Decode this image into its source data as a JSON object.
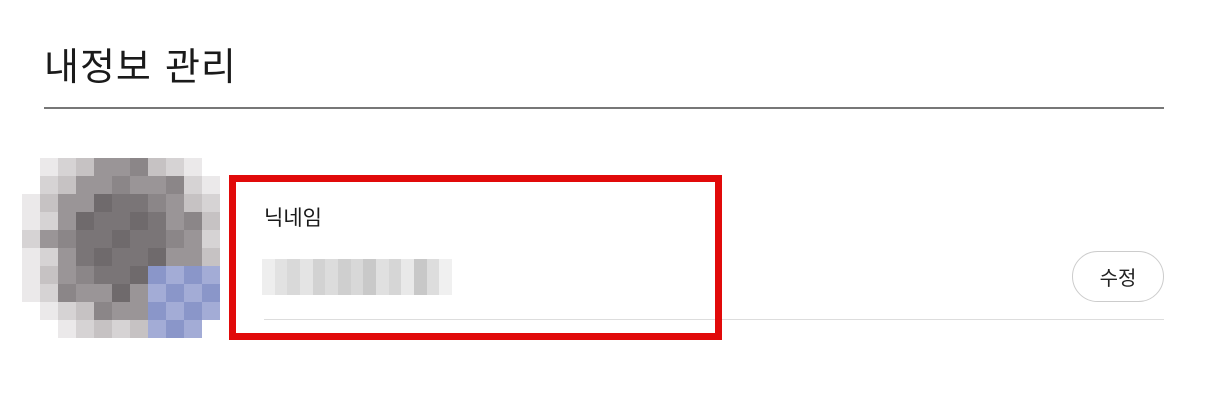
{
  "page": {
    "title": "내정보 관리"
  },
  "profile": {
    "nickname_label": "닉네임",
    "nickname_value": "",
    "edit_button_label": "수정",
    "highlight_color": "#e10a0a"
  }
}
